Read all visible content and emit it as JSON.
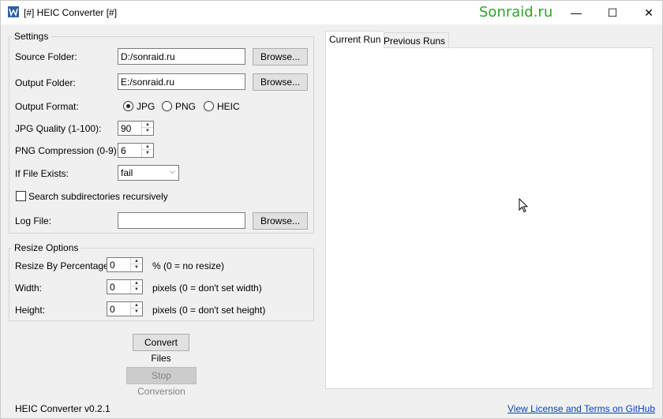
{
  "window": {
    "title": "[#] HEIC Converter [#]",
    "watermark": "Sonraid.ru",
    "controls": {
      "minimize": "—",
      "maximize": "☐",
      "close": "✕"
    }
  },
  "settings": {
    "group_title": "Settings",
    "source_folder": {
      "label": "Source Folder:",
      "value": "D:/sonraid.ru",
      "browse": "Browse..."
    },
    "output_folder": {
      "label": "Output Folder:",
      "value": "E:/sonraid.ru",
      "browse": "Browse..."
    },
    "output_format": {
      "label": "Output Format:",
      "options": [
        "JPG",
        "PNG",
        "HEIC"
      ],
      "selected": "JPG"
    },
    "jpg_quality": {
      "label": "JPG Quality (1-100):",
      "value": "90"
    },
    "png_compression": {
      "label": "PNG Compression (0-9):",
      "value": "6"
    },
    "if_file_exists": {
      "label": "If File Exists:",
      "value": "fail"
    },
    "recursive": {
      "label": "Search subdirectories recursively",
      "checked": false
    },
    "log_file": {
      "label": "Log File:",
      "value": "",
      "browse": "Browse..."
    }
  },
  "resize": {
    "group_title": "Resize Options",
    "percentage": {
      "label": "Resize By Percentage:",
      "value": "0",
      "hint": "% (0 = no resize)"
    },
    "width": {
      "label": "Width:",
      "value": "0",
      "hint": "pixels (0 = don't set width)"
    },
    "height": {
      "label": "Height:",
      "value": "0",
      "hint": "pixels (0 = don't set height)"
    }
  },
  "actions": {
    "convert": "Convert Files",
    "stop": "Stop Conversion"
  },
  "tabs": [
    {
      "label": "Current Run",
      "active": true
    },
    {
      "label": "Previous Runs",
      "active": false
    }
  ],
  "footer": {
    "version": "HEIC Converter v0.2.1",
    "license_link": "View License and Terms on GitHub"
  },
  "colors": {
    "watermark": "#2aa52a",
    "link": "#0645ad",
    "window_bg": "#f0f0f0"
  }
}
